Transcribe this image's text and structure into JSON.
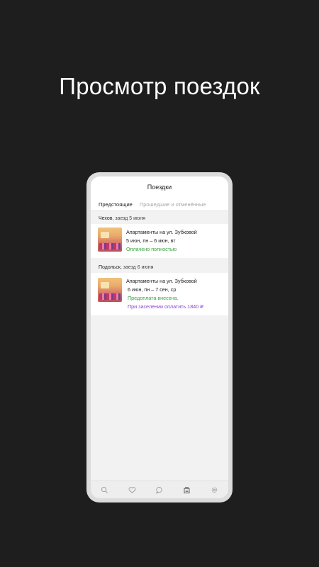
{
  "promo": {
    "title": "Просмотр поездок"
  },
  "app": {
    "header_title": "Поездки",
    "tabs": [
      {
        "label": "Предстоящие",
        "active": true
      },
      {
        "label": "Прошедшие и отменённые",
        "active": false
      }
    ],
    "trips": [
      {
        "section_city": "Чехов",
        "section_rest": ", заезд 5 июня",
        "title": "Апартаменты на ул. Зубковой",
        "dates": "5 июн, пн – 6 июн, вт",
        "status_lines": [
          {
            "text": "Оплачено полностью",
            "color": "#35a33b"
          }
        ]
      },
      {
        "section_city": "Подольск",
        "section_rest": ", заезд 6 июня",
        "title": "Апартаменты на ул. Зубковой",
        "dates": "6 июн, пн – 7 сен, ср",
        "status_lines": [
          {
            "text": "Предоплата внесена.",
            "color": "#35a33b"
          },
          {
            "text": "При заселении оплатить 1840 ₽",
            "color": "#8b3fd1"
          }
        ]
      }
    ],
    "bottom_nav": [
      "search-icon",
      "heart-icon",
      "chat-icon",
      "trips-icon",
      "gear-icon"
    ]
  }
}
